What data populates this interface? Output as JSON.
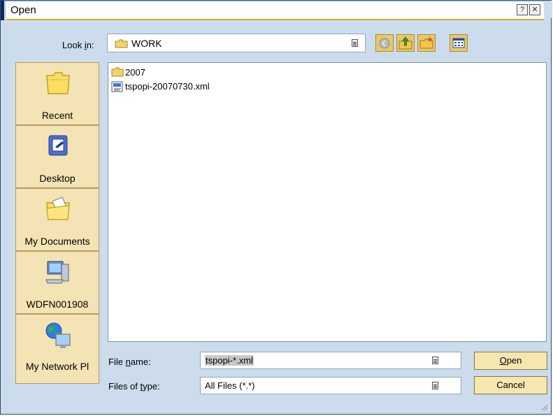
{
  "window": {
    "title": "Open"
  },
  "lookin": {
    "label_pre": "Look ",
    "label_key": "i",
    "label_post": "n:",
    "value": "WORK"
  },
  "toolbar": {
    "back_icon": "back-arrow-icon",
    "up_icon": "up-folder-icon",
    "newfolder_icon": "new-folder-icon",
    "view_icon": "view-menu-icon"
  },
  "places": [
    {
      "label": "Recent",
      "icon": "recent-folder-icon"
    },
    {
      "label": "Desktop",
      "icon": "desktop-icon"
    },
    {
      "label": "My Documents",
      "icon": "my-documents-icon"
    },
    {
      "label": "WDFN001908",
      "icon": "my-computer-icon"
    },
    {
      "label": "My Network Pl",
      "icon": "network-icon"
    }
  ],
  "files": [
    {
      "name": "2007",
      "icon": "folder-icon"
    },
    {
      "name": "tspopi-20070730.xml",
      "icon": "xml-file-icon"
    }
  ],
  "filename": {
    "label_pre": "File ",
    "label_key": "n",
    "label_post": "ame:",
    "value": "tspopi-*.xml"
  },
  "filetype": {
    "label_pre": "Files of ",
    "label_key": "t",
    "label_post": "ype:",
    "value": "All Files (*.*)"
  },
  "buttons": {
    "open_key": "O",
    "open_rest": "pen",
    "cancel": "Cancel"
  },
  "colors": {
    "accent": "#e9a52a",
    "title_dark": "#0e2a5a",
    "dialog_bg": "#ccdcec",
    "places_bg": "#f4e3b4"
  }
}
